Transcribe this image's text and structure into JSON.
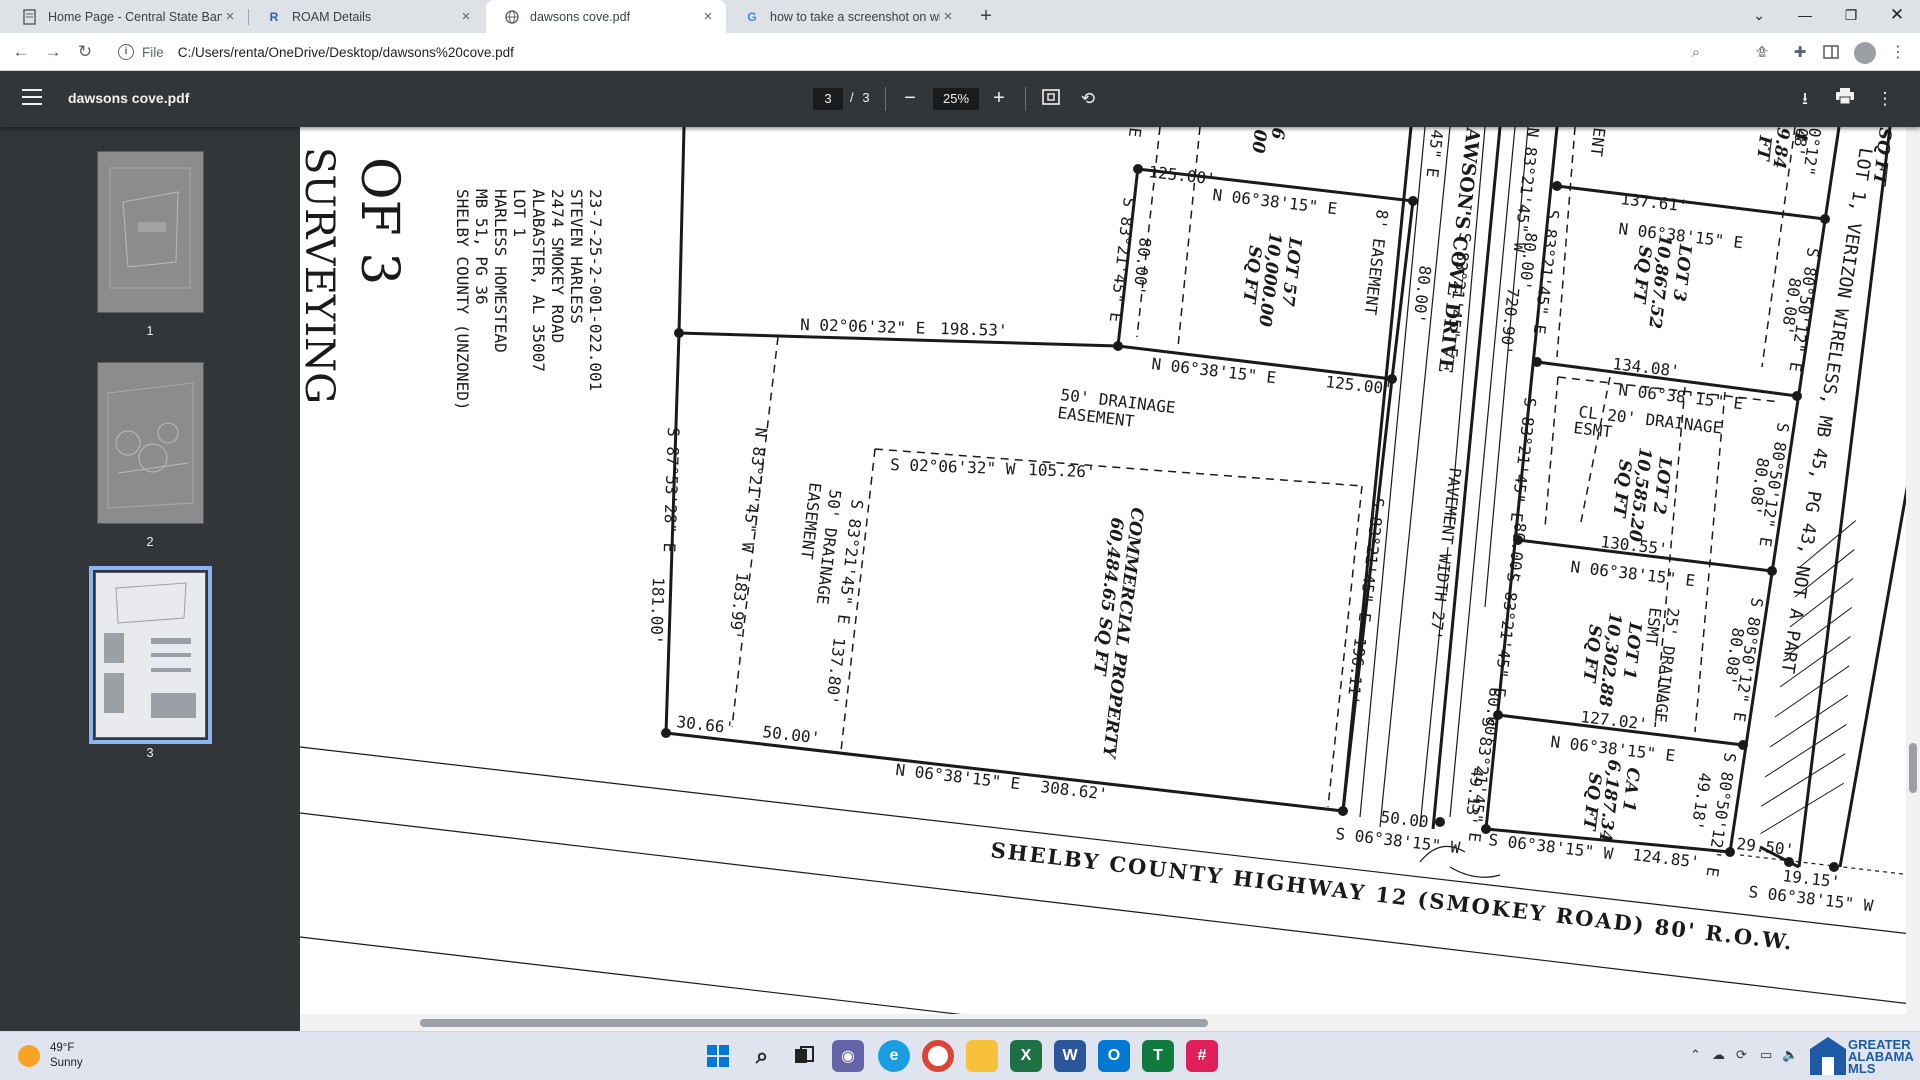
{
  "browser": {
    "tabs": [
      {
        "title": "Home Page - Central State Bank",
        "favicon": "document-icon"
      },
      {
        "title": "ROAM Details",
        "favicon": "roam-icon"
      },
      {
        "title": "dawsons cove.pdf",
        "favicon": "globe-icon"
      },
      {
        "title": "how to take a screenshot on win",
        "favicon": "google-icon"
      }
    ],
    "active_tab": 2,
    "address": {
      "scheme": "File",
      "url": "C:/Users/renta/OneDrive/Desktop/dawsons%20cove.pdf"
    }
  },
  "pdf": {
    "filename": "dawsons cove.pdf",
    "current_page": "3",
    "page_separator": "/",
    "total_pages": "3",
    "zoom": "25%",
    "thumbnails": [
      "1",
      "2",
      "3"
    ]
  },
  "plat": {
    "title_fragments": {
      "of": "OF 3",
      "surveying": "SURVEYING"
    },
    "owner_block": [
      "23-7-25-2-001-022.001",
      "STEVEN HARLESS",
      "2474 SMOKEY ROAD",
      "ALABASTER, AL 35007",
      "LOT 1",
      "HARLESS HOMESTEAD",
      "MB 51, PG 36",
      "SHELBY COUNTY (UNZONED)"
    ],
    "labels": {
      "lot57": "LOT 57",
      "lot57_area": "10,000.00",
      "lot57_unit": "SQ FT",
      "lot56_a": "6",
      "lot56_b": "00",
      "lot3": "LOT 3",
      "lot3_area": "10,867.52",
      "lot3_unit": "SQ FT",
      "lot2": "LOT 2",
      "lot2_area": "10,585.20",
      "lot2_unit": "SQ FT",
      "lot1": "LOT 1",
      "lot1_area": "10,302.88",
      "lot1_unit": "SQ FT",
      "ca1": "CA 1",
      "ca1_area": "6,187.34",
      "ca1_unit": "SQ FT",
      "commercial": "COMMERCIAL PROPERTY",
      "commercial_area": "60,484.65 SQ FT",
      "drainage_50": "50' DRAINAGE",
      "drainage_easement": "EASEMENT",
      "drainage_50b": "50' DRAINAGE",
      "drainage_easement_b": "EASEMENT",
      "easement_8": "8' EASEMENT",
      "dawsons_cove": "AWSON'S COVE DRIVE",
      "pavement": "PAVEMENT WIDTH 27'",
      "cl_drainage": "CL 20' DRAINAGE",
      "esmt": "ESMT",
      "drainage_25": "25' DRAINAGE",
      "esmt_b": "ESMT",
      "verizon": "LOT 1, VERIZON WIRELESS, MB 45, PG 43, NOT A PART",
      "sq_ft_edge": "SQ FT",
      "lot4_a": "4",
      "lot4_b": "9.84",
      "lot4_c": "FT",
      "ent": "ENT",
      "highway": "SHELBY COUNTY HIGHWAY 12 (SMOKEY ROAD) 80' R.O.W."
    },
    "bearings": {
      "b1": "N 02°06'32\" E",
      "b1_dist": "198.53'",
      "b2": "N 06°38'15\" E",
      "b2_dist": "125.00'",
      "b3": "N 06°38'15\" E",
      "b3_dist": "125.00'",
      "b4": "S 83°21'45\" E",
      "b4_dist": "80.00'",
      "b5": "S 87°53'28\" E",
      "b5_dist": "181.00'",
      "b6": "N 83°21'45\" W",
      "b6_dist": "183.99'",
      "b7": "S 02°06'32\" W",
      "b7_dist": "105.26'",
      "b8": "S 83°21'45\" E",
      "b8_dist": "137.80'",
      "b9": "S 83°21'45\" E",
      "b9_dist": "196.11'",
      "b10": "N 06°38'15\" E",
      "b10_dist": "308.62'",
      "d_3066": "30.66'",
      "d_5000": "50.00'",
      "b11": "S 06°38'15\" W",
      "b11_dist": "50.00'",
      "b12": "S 06°38'15\" W",
      "b12_dist": "124.85'",
      "b13": "S 06°38'15\" W",
      "d_1915": "19.15'",
      "d_2950": "29.50'",
      "b14": "N 06°38'15\" E",
      "b14_dist": "137.61'",
      "b15": "N 06°38'15\" E",
      "b15_dist": "134.08'",
      "b16": "N 06°38'15\" E",
      "b16_dist": "130.55'",
      "b17": "N 06°38'15\" E",
      "b17_dist": "127.02'",
      "b18": "S 80°50'12\" E",
      "b18_dist": "80.08'",
      "b19": "S 80°50'12\" E",
      "b19_dist": "80.08'",
      "b20": "S 80°50'12\" E",
      "b20_dist": "80.08'",
      "b21": "S 80°50'12\" E",
      "b21_dist": "49.18'",
      "b22": "S 83°21'45\" E",
      "b22_dist": "80.00'",
      "b23": "S 83°21'45\" E",
      "b23_dist": "80.00'",
      "b24": "S 83°21'45\" E",
      "b24_dist": "80.00'",
      "b25": "S 83°21'45\" E",
      "b25_dist": "49.13'",
      "b26": "N 83°21'45\" W",
      "b26_dist": "720.90'",
      "d_8000_top": "80.00'",
      "e1": "E",
      "e2": "45\" E",
      "b27": "S 83°21'45\" E",
      "b27_dist": "80.00'",
      "top_b": "0°12\"",
      "top_c": "08'"
    }
  },
  "taskbar": {
    "temperature": "49°F",
    "condition": "Sunny",
    "logo_text": [
      "GREATER",
      "ALABAMA",
      "MLS"
    ]
  },
  "colors": {
    "accent": "#8ab4f8",
    "pdf_toolbar": "#323639",
    "tabstrip": "#dee1e6"
  }
}
